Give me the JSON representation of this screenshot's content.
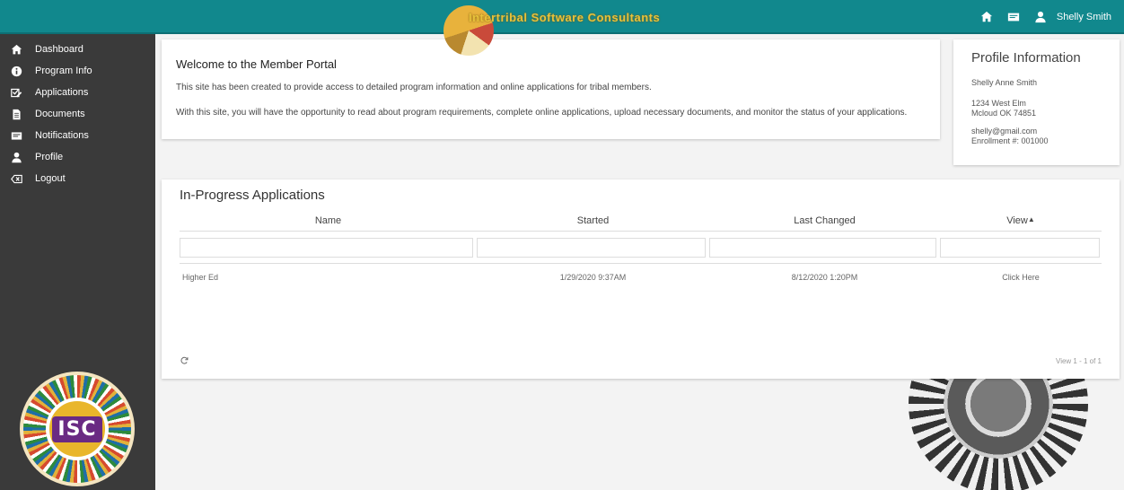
{
  "header": {
    "brand_title": "Intertribal Software Consultants",
    "user_name": "Shelly Smith",
    "icons": [
      "home-icon",
      "message-icon",
      "user-icon"
    ],
    "background_color": "#11888d"
  },
  "sidebar": {
    "items": [
      {
        "label": "Dashboard",
        "icon": "home-icon"
      },
      {
        "label": "Program Info",
        "icon": "info-icon"
      },
      {
        "label": "Applications",
        "icon": "edit-checkbox-icon"
      },
      {
        "label": "Documents",
        "icon": "document-icon"
      },
      {
        "label": "Notifications",
        "icon": "notification-icon"
      },
      {
        "label": "Profile",
        "icon": "user-icon"
      },
      {
        "label": "Logout",
        "icon": "logout-icon"
      }
    ],
    "logo_text": "ISC",
    "background_color": "#3a3a3a"
  },
  "welcome": {
    "title": "Welcome to the Member Portal",
    "paragraph1": "This site has been created to provide access to detailed program information and online applications for tribal members.",
    "paragraph2": "With this site, you will have the opportunity to read about program requirements, complete online applications, upload necessary documents, and monitor the status of your applications."
  },
  "profile": {
    "title": "Profile Information",
    "full_name": "Shelly Anne Smith",
    "address_line1": "1234 West Elm",
    "address_line2": "Mcloud OK 74851",
    "email": "shelly@gmail.com",
    "enrollment": "Enrollment #:  001000"
  },
  "applications": {
    "title": "In-Progress Applications",
    "columns": [
      "Name",
      "Started",
      "Last Changed",
      "View"
    ],
    "rows": [
      {
        "name": "Higher Ed",
        "started": "1/29/2020 9:37AM",
        "last_changed": "8/12/2020 1:20PM",
        "view": "Click Here"
      }
    ],
    "pager_text": "View 1 - 1 of 1"
  }
}
